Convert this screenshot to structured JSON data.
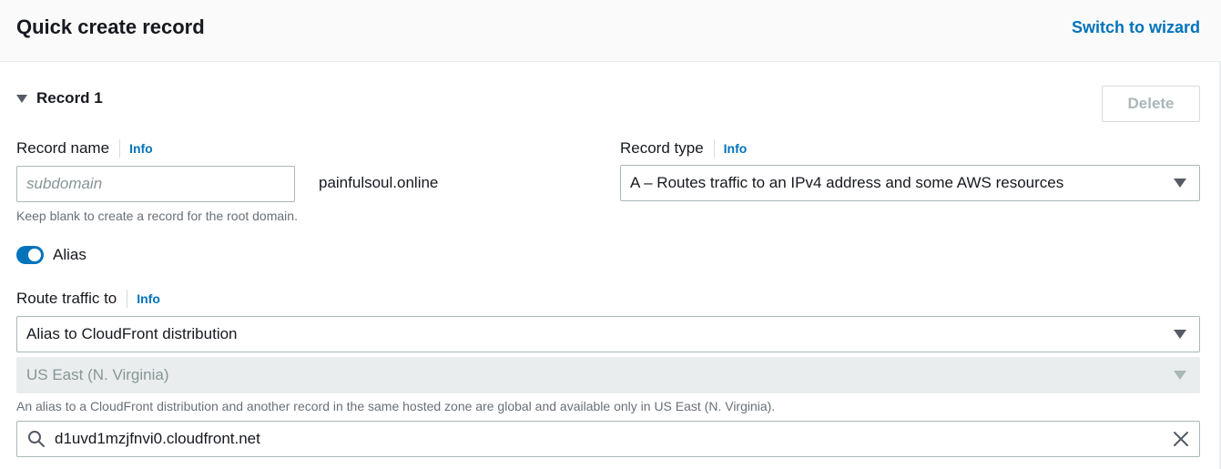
{
  "header": {
    "title": "Quick create record",
    "switch_link": "Switch to wizard"
  },
  "record": {
    "section_title": "Record 1",
    "delete_label": "Delete",
    "record_name": {
      "label": "Record name",
      "info": "Info",
      "placeholder": "subdomain",
      "value": "",
      "domain_suffix": "painfulsoul.online",
      "hint": "Keep blank to create a record for the root domain."
    },
    "record_type": {
      "label": "Record type",
      "info": "Info",
      "selected": "A – Routes traffic to an IPv4 address and some AWS resources"
    },
    "alias": {
      "label": "Alias",
      "enabled": true
    },
    "route_traffic": {
      "label": "Route traffic to",
      "info": "Info",
      "endpoint_selected": "Alias to CloudFront distribution",
      "region_selected": "US East (N. Virginia)",
      "hint": "An alias to a CloudFront distribution and another record in the same hosted zone are global and available only in US East (N. Virginia).",
      "search_value": "d1uvd1mzjfnvi0.cloudfront.net"
    }
  },
  "icons": {
    "section": "caret-down-icon",
    "select": "caret-down-icon",
    "search": "search-icon",
    "clear": "close-icon"
  },
  "colors": {
    "accent": "#0073bb",
    "text": "#16191f",
    "muted": "#687078",
    "disabled_bg": "#eaeded"
  }
}
